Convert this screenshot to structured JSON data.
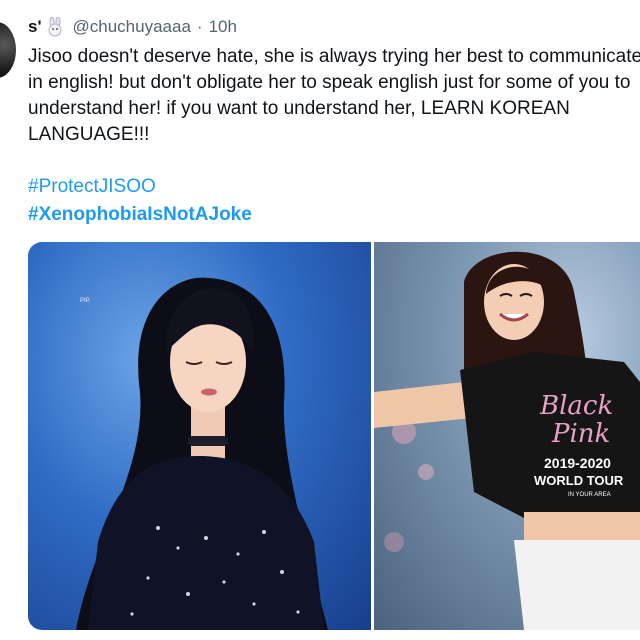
{
  "tweet": {
    "display_name": "s'",
    "handle": "@chuchuyaaaa",
    "separator": "·",
    "time": "10h",
    "text_lines": [
      "Jisoo doesn't deserve hate, she is always trying her best to communicate",
      "in english! but don't obligate her to speak english just for some of you to",
      "understand her! if you want to understand her, LEARN KOREAN",
      "LANGUAGE!!!"
    ],
    "hashtags": [
      "#ProtectJISOO",
      "#XenophobiaIsNotAJoke"
    ]
  },
  "media": {
    "left_photo_tag": "PIP.",
    "shirt_text": {
      "line1": "Black",
      "line2": "Pink",
      "line3": "2019-2020",
      "line4": "WORLD TOUR",
      "line5": "IN YOUR AREA"
    }
  },
  "icons": {
    "display_emoji": "rabbit-icon"
  },
  "colors": {
    "hashtag": "#1d9bf0",
    "secondary_text": "#536471",
    "primary_text": "#0f1419"
  }
}
